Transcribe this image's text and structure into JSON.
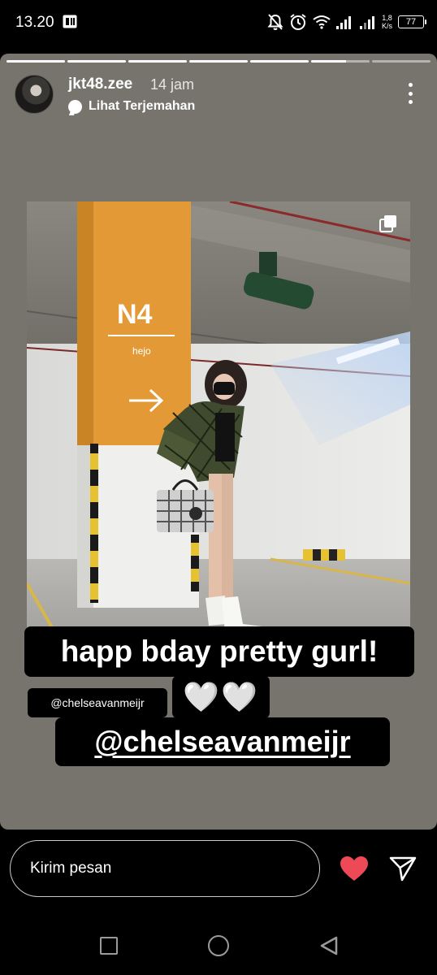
{
  "status_bar": {
    "time": "13.20",
    "net_speed_value": "1,8",
    "net_speed_unit": "K/s",
    "battery": "77",
    "icons": [
      "app-notification-icon",
      "mute-icon",
      "alarm-icon",
      "wifi-icon",
      "signal-icon",
      "signal-icon",
      "battery-icon"
    ]
  },
  "story": {
    "progress": {
      "segments": 7,
      "current_index": 5,
      "current_fill": 0.6
    },
    "username": "jkt48.zee",
    "time_ago": "14 jam",
    "translate_label": "Lihat Terjemahan",
    "caption_line1": "happ bday pretty gurl!",
    "caption_line2": "🤍🤍",
    "caption_line3": "@chelseavanmeijr",
    "mention_sticker": "@chelseavanmeijr",
    "photo_sign": {
      "code": "N4",
      "word": "hejo"
    },
    "colors": {
      "background": "#76746d",
      "pillar": "#e39a36",
      "accent_heart": "#ed4956"
    }
  },
  "reply_bar": {
    "placeholder": "Kirim pesan",
    "icons": [
      "heart-icon",
      "send-icon"
    ]
  },
  "nav_bar": {
    "icons": [
      "recents-icon",
      "home-icon",
      "back-icon"
    ]
  }
}
